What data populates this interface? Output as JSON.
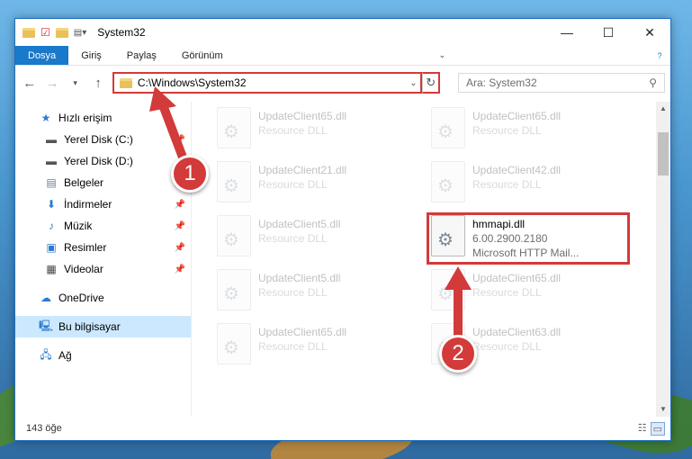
{
  "window": {
    "title": "System32"
  },
  "ribbon": {
    "tabs": [
      "Dosya",
      "Giriş",
      "Paylaş",
      "Görünüm"
    ]
  },
  "address": {
    "path": "C:\\Windows\\System32",
    "search_placeholder": "Ara: System32"
  },
  "nav": {
    "quick_access": "Hızlı erişim",
    "items": [
      {
        "label": "Yerel Disk (C:)",
        "icon": "drive-icon",
        "pinned": true
      },
      {
        "label": "Yerel Disk (D:)",
        "icon": "drive-icon",
        "pinned": false
      },
      {
        "label": "Belgeler",
        "icon": "documents-icon",
        "pinned": true
      },
      {
        "label": "İndirmeler",
        "icon": "download-icon",
        "pinned": true
      },
      {
        "label": "Müzik",
        "icon": "music-icon",
        "pinned": true
      },
      {
        "label": "Resimler",
        "icon": "pictures-icon",
        "pinned": true
      },
      {
        "label": "Videolar",
        "icon": "videos-icon",
        "pinned": true
      }
    ],
    "onedrive": "OneDrive",
    "this_pc": "Bu bilgisayar",
    "network": "Ağ"
  },
  "files": [
    {
      "name": "UpdateClient65.dll",
      "desc": "Resource DLL"
    },
    {
      "name": "UpdateClient65.dll",
      "desc": "Resource DLL"
    },
    {
      "name": "UpdateClient21.dll",
      "desc": "Resource DLL"
    },
    {
      "name": "UpdateClient42.dll",
      "desc": "Resource DLL"
    },
    {
      "name": "UpdateClient5.dll",
      "desc": "Resource DLL"
    },
    {
      "name": "hmmapi.dll",
      "version": "6.00.2900.2180",
      "desc": "Microsoft HTTP Mail..."
    },
    {
      "name": "UpdateClient5.dll",
      "desc": "Resource DLL"
    },
    {
      "name": "UpdateClient65.dll",
      "desc": "Resource DLL"
    },
    {
      "name": "UpdateClient65.dll",
      "desc": "Resource DLL"
    },
    {
      "name": "UpdateClient63.dll",
      "desc": "Resource DLL"
    }
  ],
  "status": {
    "count": "143 öğe"
  },
  "callouts": [
    "1",
    "2"
  ],
  "colors": {
    "accent": "#1979ca",
    "highlight": "#d33a3a",
    "selected": "#cce8ff"
  }
}
